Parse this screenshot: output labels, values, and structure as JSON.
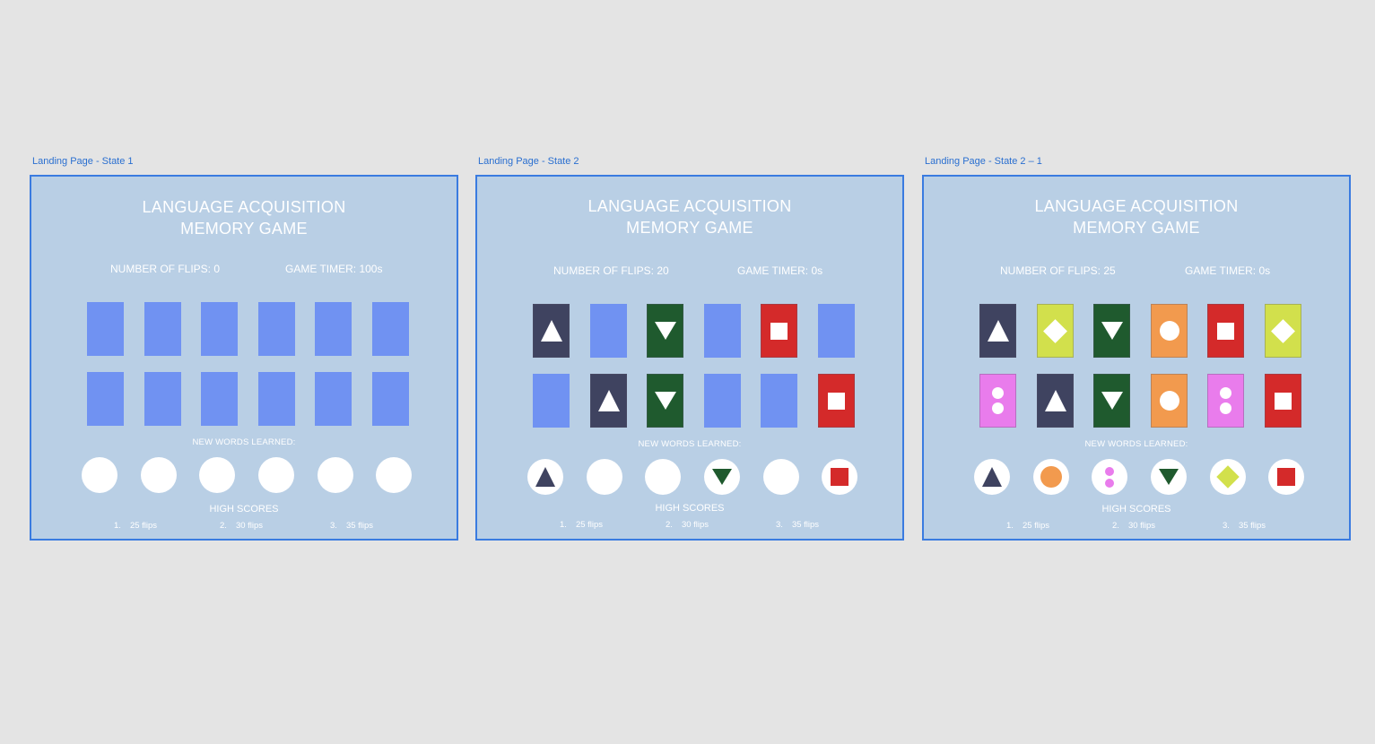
{
  "colors": {
    "canvas_bg": "#e4e4e4",
    "frame_bg": "#b9cfe5",
    "frame_border": "#3a7be0",
    "card_back": "#7092f2",
    "navy": "#3f4360",
    "green": "#1f5a2e",
    "red": "#d42a2a",
    "orange": "#f29a4e",
    "lime": "#d2e04c",
    "pink": "#e97cec"
  },
  "frames": [
    {
      "label": "Landing Page - State 1",
      "title_line1": "LANGUAGE  ACQUISITION",
      "title_line2": "MEMORY GAME",
      "flips": "NUMBER OF FLIPS: 0",
      "timer": "GAME TIMER: 100s",
      "cards_row1": [
        "back",
        "back",
        "back",
        "back",
        "back",
        "back"
      ],
      "cards_row2": [
        "back",
        "back",
        "back",
        "back",
        "back",
        "back"
      ],
      "new_words_label": "NEW WORDS LEARNED:",
      "words": [
        "empty",
        "empty",
        "empty",
        "empty",
        "empty",
        "empty"
      ],
      "high_scores_title": "HIGH SCORES",
      "high_scores": [
        {
          "rank": "1.",
          "score": "25 flips"
        },
        {
          "rank": "2.",
          "score": "30 flips"
        },
        {
          "rank": "3.",
          "score": "35 flips"
        }
      ]
    },
    {
      "label": "Landing Page - State 2",
      "title_line1": "LANGUAGE  ACQUISITION",
      "title_line2": "MEMORY GAME",
      "flips": "NUMBER OF FLIPS: 20",
      "timer": "GAME TIMER: 0s",
      "cards_row1": [
        "triangle-up",
        "back",
        "triangle-down",
        "back",
        "square",
        "back"
      ],
      "cards_row2": [
        "back",
        "triangle-up",
        "triangle-down",
        "back",
        "back",
        "square"
      ],
      "new_words_label": "NEW WORDS LEARNED:",
      "words": [
        "triangle-up",
        "empty",
        "empty",
        "triangle-down",
        "empty",
        "square"
      ],
      "high_scores_title": "HIGH SCORES",
      "high_scores": [
        {
          "rank": "1.",
          "score": "25 flips"
        },
        {
          "rank": "2.",
          "score": "30 flips"
        },
        {
          "rank": "3.",
          "score": "35 flips"
        }
      ]
    },
    {
      "label": "Landing Page - State 2 – 1",
      "title_line1": "LANGUAGE  ACQUISITION",
      "title_line2": "MEMORY GAME",
      "flips": "NUMBER OF FLIPS: 25",
      "timer": "GAME TIMER: 0s",
      "cards_row1": [
        "triangle-up",
        "diamond",
        "triangle-down",
        "circle",
        "square",
        "diamond"
      ],
      "cards_row2": [
        "two-dots",
        "triangle-up",
        "triangle-down",
        "circle",
        "two-dots",
        "square"
      ],
      "new_words_label": "NEW WORDS LEARNED:",
      "words": [
        "triangle-up",
        "circle",
        "two-dots",
        "triangle-down",
        "diamond",
        "square"
      ],
      "high_scores_title": "HIGH SCORES",
      "high_scores": [
        {
          "rank": "1.",
          "score": "25 flips"
        },
        {
          "rank": "2.",
          "score": "30 flips"
        },
        {
          "rank": "3.",
          "score": "35 flips"
        }
      ]
    }
  ]
}
